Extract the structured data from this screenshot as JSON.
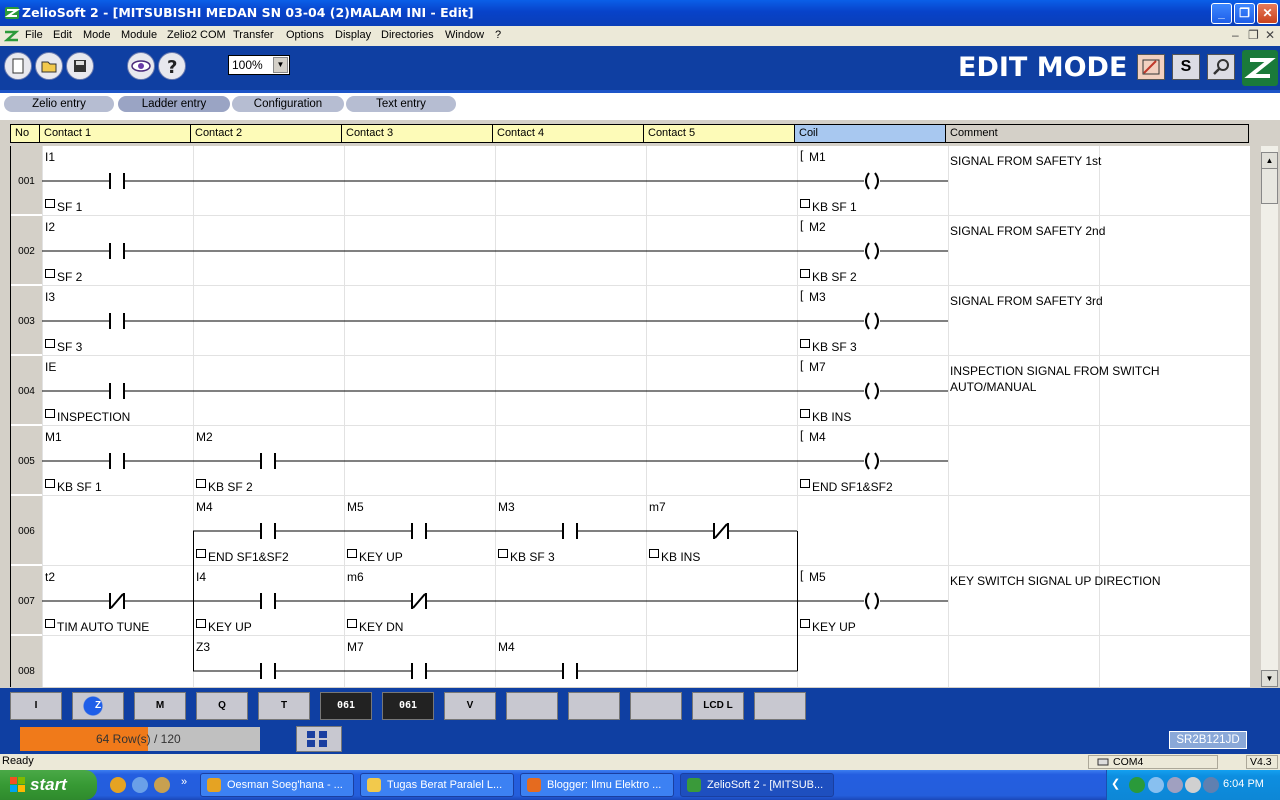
{
  "window": {
    "title": "ZelioSoft 2 - [MITSUBISHI MEDAN SN 03-04 (2)MALAM INI - Edit]",
    "minimize": "_",
    "maximize": "❐",
    "close": "✕"
  },
  "menu": {
    "items": [
      "File",
      "Edit",
      "Mode",
      "Module",
      "Zelio2 COM",
      "Transfer",
      "Options",
      "Display",
      "Directories",
      "Window",
      "?"
    ]
  },
  "toolbar": {
    "zoom": "100%",
    "mode_label": "EDIT MODE",
    "mode_buttons": [
      "S"
    ]
  },
  "tabs": [
    "Zelio entry",
    "Ladder entry",
    "Configuration",
    "Text entry"
  ],
  "grid": {
    "headers": {
      "no": "No",
      "contact1": "Contact 1",
      "contact2": "Contact 2",
      "contact3": "Contact 3",
      "contact4": "Contact 4",
      "contact5": "Contact 5",
      "coil": "Coil",
      "comment": "Comment"
    },
    "rows": [
      {
        "num": "001",
        "comment": [
          "SIGNAL FROM SAFETY 1st"
        ]
      },
      {
        "num": "002",
        "comment": [
          "SIGNAL FROM SAFETY 2nd"
        ]
      },
      {
        "num": "003",
        "comment": [
          "SIGNAL FROM SAFETY 3rd"
        ]
      },
      {
        "num": "004",
        "comment": [
          "INSPECTION SIGNAL FROM SWITCH",
          "AUTO/MANUAL"
        ]
      },
      {
        "num": "005",
        "comment": []
      },
      {
        "num": "006",
        "comment": []
      },
      {
        "num": "007",
        "comment": [
          "KEY SWITCH SIGNAL UP DIRECTION"
        ]
      },
      {
        "num": "008",
        "comment": []
      }
    ],
    "contacts": [
      {
        "row": 0,
        "col": 0,
        "addr": "I1",
        "label": "SF 1",
        "type": "NO"
      },
      {
        "row": 1,
        "col": 0,
        "addr": "I2",
        "label": "SF 2",
        "type": "NO"
      },
      {
        "row": 2,
        "col": 0,
        "addr": "I3",
        "label": "SF 3",
        "type": "NO"
      },
      {
        "row": 3,
        "col": 0,
        "addr": "IE",
        "label": "INSPECTION",
        "type": "NO"
      },
      {
        "row": 4,
        "col": 0,
        "addr": "M1",
        "label": "KB SF 1",
        "type": "NO"
      },
      {
        "row": 4,
        "col": 1,
        "addr": "M2",
        "label": "KB SF 2",
        "type": "NO"
      },
      {
        "row": 5,
        "col": 1,
        "addr": "M4",
        "label": "END SF1&SF2",
        "type": "NO"
      },
      {
        "row": 5,
        "col": 2,
        "addr": "M5",
        "label": "KEY UP",
        "type": "NO"
      },
      {
        "row": 5,
        "col": 3,
        "addr": "M3",
        "label": "KB SF 3",
        "type": "NO"
      },
      {
        "row": 5,
        "col": 4,
        "addr": "m7",
        "label": "KB INS",
        "type": "NC"
      },
      {
        "row": 6,
        "col": 0,
        "addr": "t2",
        "label": "TIM AUTO TUNE",
        "type": "NC"
      },
      {
        "row": 6,
        "col": 1,
        "addr": "I4",
        "label": "KEY UP",
        "type": "NO"
      },
      {
        "row": 6,
        "col": 2,
        "addr": "m6",
        "label": "KEY DN",
        "type": "NC"
      },
      {
        "row": 7,
        "col": 1,
        "addr": "Z3",
        "label": "",
        "type": "NO"
      },
      {
        "row": 7,
        "col": 2,
        "addr": "M7",
        "label": "",
        "type": "NO"
      },
      {
        "row": 7,
        "col": 3,
        "addr": "M4",
        "label": "",
        "type": "NO"
      }
    ],
    "coils": [
      {
        "row": 0,
        "addr": "M1",
        "label": "KB SF 1"
      },
      {
        "row": 1,
        "addr": "M2",
        "label": "KB SF 2"
      },
      {
        "row": 2,
        "addr": "M3",
        "label": "KB SF 3"
      },
      {
        "row": 3,
        "addr": "M7",
        "label": "KB INS"
      },
      {
        "row": 4,
        "addr": "M4",
        "label": "END SF1&SF2"
      },
      {
        "row": 6,
        "addr": "M5",
        "label": "KEY UP"
      }
    ]
  },
  "function_toolbar": {
    "buttons": [
      {
        "name": "contact-input-button",
        "text": "I"
      },
      {
        "name": "aux-relay-z-button",
        "text": "Z"
      },
      {
        "name": "aux-relay-m-button",
        "text": "M"
      },
      {
        "name": "output-q-button",
        "text": "Q"
      },
      {
        "name": "timer-button",
        "text": "T"
      },
      {
        "name": "counter-button",
        "text": "061"
      },
      {
        "name": "fast-counter-button",
        "text": "061"
      },
      {
        "name": "comparator-button",
        "text": "V"
      },
      {
        "name": "analog-button",
        "text": ""
      },
      {
        "name": "clock-button",
        "text": ""
      },
      {
        "name": "text-block-button",
        "text": ""
      },
      {
        "name": "lcd-button",
        "text": "LCD L"
      },
      {
        "name": "light-button",
        "text": ""
      }
    ]
  },
  "progress": {
    "text": "64 Row(s) / 120",
    "fraction": 0.533
  },
  "model": "SR2B121JD",
  "status": {
    "ready": "Ready",
    "port": "COM4",
    "version": "V4.3"
  },
  "taskbar": {
    "start": "start",
    "tasks": [
      {
        "label": "Oesman Soeg'hana - ...",
        "color": "#e5a323"
      },
      {
        "label": "Tugas Berat Paralel L...",
        "color": "#f2c94c"
      },
      {
        "label": "Blogger: Ilmu Elektro ...",
        "color": "#e56b1f"
      },
      {
        "label": "ZelioSoft 2 - [MITSUB...",
        "color": "#3a9a3a"
      }
    ],
    "clock": "6:04 PM"
  },
  "colors": {
    "titlebar": "#0842c9",
    "header_contact": "#fdfbb8",
    "header_coil": "#a8c8f0",
    "toolbar_bg": "#0f3fa2",
    "progress": "#f07a1a"
  }
}
